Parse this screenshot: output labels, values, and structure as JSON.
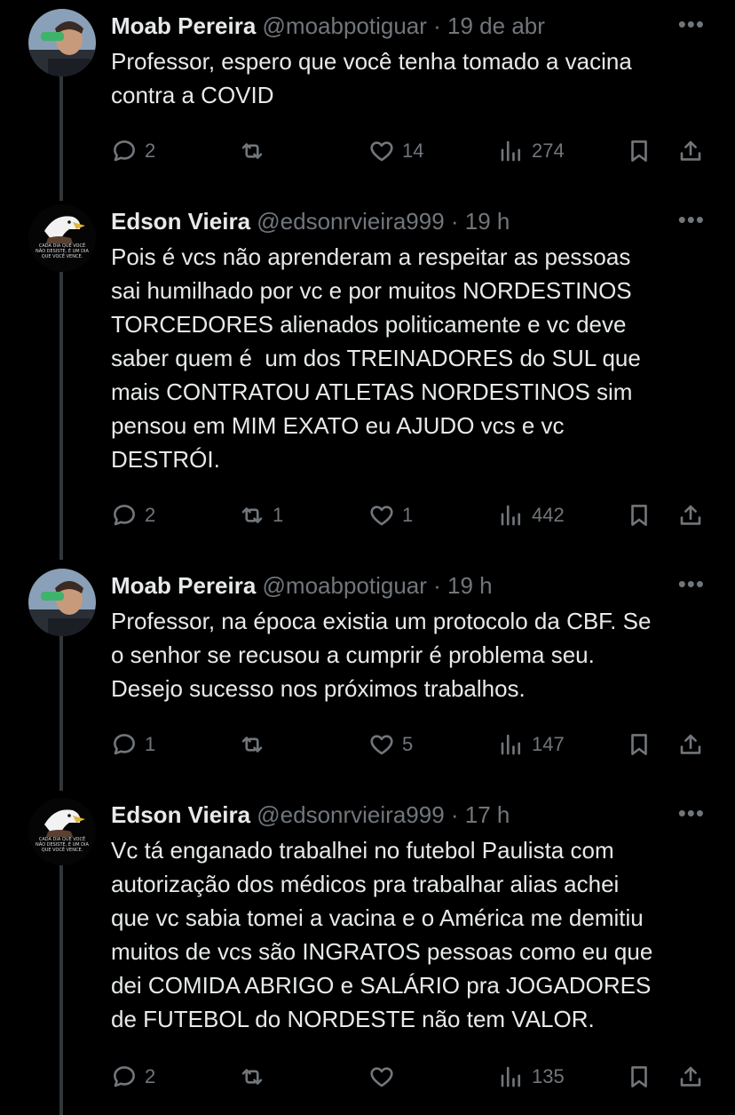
{
  "tweets": [
    {
      "author": "Moab Pereira",
      "handle": "@moabpotiguar",
      "time": "· 19 de abr",
      "avatar": "man-with-bottle-photo",
      "text": "Professor, espero que você tenha tomado a vacina\ncontra a COVID",
      "replies": "2",
      "retweets": "",
      "likes": "14",
      "views": "274"
    },
    {
      "author": "Edson Vieira",
      "handle": "@edsonrvieira999",
      "time": "· 19 h",
      "avatar": "eagle-motivational-image",
      "avatar_caption": "CADA DIA QUE VOCÊ NÃO DESISTE, É UM DIA QUE VOCÊ VENCE.",
      "text": "Pois é vcs não aprenderam a respeitar as pessoas\nsai humilhado por vc e por muitos NORDESTINOS\nTORCEDORES alienados politicamente e vc deve\nsaber quem é  um dos TREINADORES do SUL que\nmais CONTRATOU ATLETAS NORDESTINOS sim\npensou em MIM EXATO eu AJUDO vcs e vc\nDESTRÓI.",
      "replies": "2",
      "retweets": "1",
      "likes": "1",
      "views": "442"
    },
    {
      "author": "Moab Pereira",
      "handle": "@moabpotiguar",
      "time": "· 19 h",
      "avatar": "man-with-bottle-photo",
      "text": "Professor, na época existia um protocolo da CBF. Se\no senhor se recusou a cumprir é problema seu.\nDesejo sucesso nos próximos trabalhos.",
      "replies": "1",
      "retweets": "",
      "likes": "5",
      "views": "147"
    },
    {
      "author": "Edson Vieira",
      "handle": "@edsonrvieira999",
      "time": "· 17 h",
      "avatar": "eagle-motivational-image",
      "avatar_caption": "CADA DIA QUE VOCÊ NÃO DESISTE, É UM DIA QUE VOCÊ VENCE.",
      "text": "Vc tá enganado trabalhei no futebol Paulista com\nautorização dos médicos pra trabalhar alias achei\nque vc sabia tomei a vacina e o América me demitiu\nmuitos de vcs são INGRATOS pessoas como eu que\ndei COMIDA ABRIGO e SALÁRIO pra JOGADORES\nde FUTEBOL do NORDESTE não tem VALOR.",
      "replies": "2",
      "retweets": "",
      "likes": "",
      "views": "135"
    }
  ],
  "more_label": "•••",
  "colors": {
    "background": "#000000",
    "text": "#e7e9ea",
    "muted": "#71767b",
    "thread_line": "#333639"
  }
}
